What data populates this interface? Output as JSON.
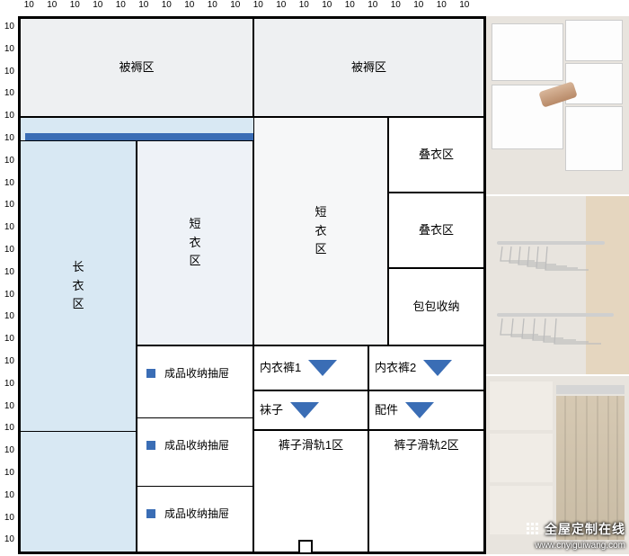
{
  "ruler_unit": "10",
  "zones": {
    "quilt_left": "被褥区",
    "quilt_right": "被褥区",
    "long_hang": "长\n衣\n区",
    "short_hang_1": "短\n衣\n区",
    "short_hang_2": "短\n衣\n区",
    "fold_1": "叠衣区",
    "fold_2": "叠衣区",
    "bag": "包包收纳",
    "drawer": "成品收纳抽屉",
    "underwear_1": "内衣裤1",
    "underwear_2": "内衣裤2",
    "socks": "袜子",
    "accessories": "配件",
    "pants_rail_1": "裤子滑轨1区",
    "pants_rail_2": "裤子滑轨2区"
  },
  "watermark": {
    "brand": "全屋定制在线",
    "url": "www.cnyiguiwang.com"
  },
  "ruler_count_top": 20,
  "ruler_count_left": 24,
  "photos": {
    "p1_alt": "storage-drawers-photo",
    "p2_alt": "pull-out-hanger-photo",
    "p3_alt": "closet-interior-photo"
  }
}
